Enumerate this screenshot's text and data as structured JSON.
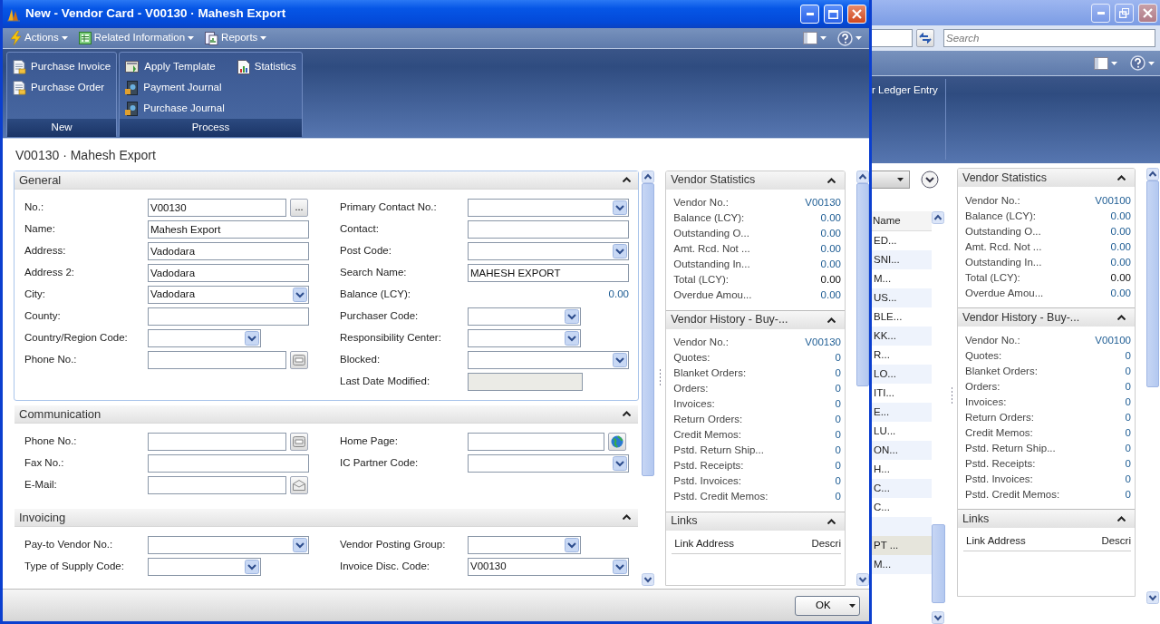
{
  "window": {
    "title": "New - Vendor Card - V00130 · Mahesh Export"
  },
  "menu": [
    {
      "label": "Actions",
      "kind": "bolt"
    },
    {
      "label": "Related Information",
      "kind": "grid"
    },
    {
      "label": "Reports",
      "kind": "report"
    }
  ],
  "ribbon": [
    {
      "label": "New",
      "actions": [
        {
          "label": "Purchase Invoice",
          "kind": "document"
        },
        {
          "label": "Purchase Order",
          "kind": "document"
        }
      ]
    },
    {
      "label": "Process",
      "actions": [
        {
          "label": "Apply Template",
          "kind": "template"
        },
        {
          "label": "Payment Journal",
          "kind": "journal"
        },
        {
          "label": "Purchase Journal",
          "kind": "journal"
        },
        {
          "label": "Statistics",
          "kind": "chart"
        }
      ]
    }
  ],
  "page_title": "V00130 · Mahesh Export",
  "fasttabs": [
    {
      "title": "General",
      "expanded": true,
      "left": [
        {
          "label": "No.:",
          "value": "V00130",
          "kind": "assist",
          "button": "..."
        },
        {
          "label": "Name:",
          "value": "Mahesh Export",
          "kind": "text"
        },
        {
          "label": "Address:",
          "value": "Vadodara",
          "kind": "text"
        },
        {
          "label": "Address 2:",
          "value": "Vadodara",
          "kind": "text"
        },
        {
          "label": "City:",
          "value": "Vadodara",
          "kind": "combo"
        },
        {
          "label": "County:",
          "kind": "text"
        },
        {
          "label": "Country/Region Code:",
          "kind": "short-combo"
        },
        {
          "label": "Phone No.:",
          "kind": "phone"
        }
      ],
      "right": [
        {
          "label": "Primary Contact No.:",
          "kind": "combo"
        },
        {
          "label": "Contact:",
          "kind": "text"
        },
        {
          "label": "Post Code:",
          "kind": "combo"
        },
        {
          "label": "Search Name:",
          "value": "MAHESH EXPORT",
          "kind": "text"
        },
        {
          "label": "Balance (LCY):",
          "value": "0.00",
          "kind": "value"
        },
        {
          "label": "Purchaser Code:",
          "kind": "short-combo"
        },
        {
          "label": "Responsibility Center:",
          "kind": "short-combo"
        },
        {
          "label": "Blocked:",
          "kind": "combo"
        },
        {
          "label": "Last Date Modified:",
          "kind": "readonly"
        }
      ]
    },
    {
      "title": "Communication",
      "expanded": true,
      "left": [
        {
          "label": "Phone No.:",
          "kind": "phone"
        },
        {
          "label": "Fax No.:",
          "kind": "text"
        },
        {
          "label": "E-Mail:",
          "kind": "email"
        }
      ],
      "right": [
        {
          "label": "Home Page:",
          "kind": "web"
        },
        {
          "label": "IC Partner Code:",
          "kind": "combo"
        }
      ]
    },
    {
      "title": "Invoicing",
      "expanded": true,
      "left": [
        {
          "label": "Pay-to Vendor No.:",
          "kind": "combo"
        },
        {
          "label": "Type of Supply Code:",
          "kind": "short-combo"
        }
      ],
      "right": [
        {
          "label": "Vendor Posting Group:",
          "kind": "short-combo"
        },
        {
          "label": "Invoice Disc. Code:",
          "value": "V00130",
          "kind": "combo"
        }
      ]
    }
  ],
  "factboxes": [
    {
      "title": "Vendor Statistics",
      "expanded": true,
      "rows": [
        {
          "label": "Vendor No.:",
          "value": "V00130",
          "link": true
        },
        {
          "label": "Balance (LCY):",
          "value": "0.00",
          "link": true
        },
        {
          "label": "Outstanding O...",
          "value": "0.00",
          "link": true
        },
        {
          "label": "Amt. Rcd. Not ...",
          "value": "0.00",
          "link": true
        },
        {
          "label": "Outstanding In...",
          "value": "0.00",
          "link": true
        },
        {
          "label": "Total (LCY):",
          "value": "0.00",
          "link": false
        },
        {
          "label": "Overdue Amou...",
          "value": "0.00",
          "link": true
        }
      ]
    },
    {
      "title": "Vendor History - Buy-...",
      "expanded": true,
      "rows": [
        {
          "label": "Vendor No.:",
          "value": "V00130",
          "link": true
        },
        {
          "label": "Quotes:",
          "value": "0",
          "link": true
        },
        {
          "label": "Blanket Orders:",
          "value": "0",
          "link": true
        },
        {
          "label": "Orders:",
          "value": "0",
          "link": true
        },
        {
          "label": "Invoices:",
          "value": "0",
          "link": true
        },
        {
          "label": "Return Orders:",
          "value": "0",
          "link": true
        },
        {
          "label": "Credit Memos:",
          "value": "0",
          "link": true
        },
        {
          "label": "Pstd. Return Ship...",
          "value": "0",
          "link": true
        },
        {
          "label": "Pstd. Receipts:",
          "value": "0",
          "link": true
        },
        {
          "label": "Pstd. Invoices:",
          "value": "0",
          "link": true
        },
        {
          "label": "Pstd. Credit Memos:",
          "value": "0",
          "link": true
        }
      ]
    },
    {
      "title": "Links",
      "expanded": true,
      "columns": [
        "Link Address",
        "Descri"
      ]
    }
  ],
  "footer": {
    "ok": "OK"
  },
  "background_window": {
    "search": {
      "placeholder": "Search"
    },
    "ribbon_action": "r Ledger Entry",
    "list": {
      "column": "Name",
      "rows": [
        {
          "name": "ED...",
          "selected": false
        },
        {
          "name": "SNI...",
          "selected": false
        },
        {
          "name": "M...",
          "selected": false
        },
        {
          "name": "US...",
          "selected": false
        },
        {
          "name": "BLE...",
          "selected": false
        },
        {
          "name": "KK...",
          "selected": false
        },
        {
          "name": "R...",
          "selected": false
        },
        {
          "name": "LO...",
          "selected": false
        },
        {
          "name": "ITI...",
          "selected": false
        },
        {
          "name": "E...",
          "selected": false
        },
        {
          "name": "LU...",
          "selected": false
        },
        {
          "name": "ON...",
          "selected": false
        },
        {
          "name": "H...",
          "selected": false
        },
        {
          "name": "C...",
          "selected": false
        },
        {
          "name": "C...",
          "selected": false
        },
        {
          "selected": false
        },
        {
          "name": "PT ...",
          "selected": true
        },
        {
          "name": "M...",
          "selected": false
        }
      ]
    },
    "factboxes": [
      {
        "title": "Vendor Statistics",
        "expanded": true,
        "rows": [
          {
            "label": "Vendor No.:",
            "value": "V00100",
            "link": true
          },
          {
            "label": "Balance (LCY):",
            "value": "0.00",
            "link": true
          },
          {
            "label": "Outstanding O...",
            "value": "0.00",
            "link": true
          },
          {
            "label": "Amt. Rcd. Not ...",
            "value": "0.00",
            "link": true
          },
          {
            "label": "Outstanding In...",
            "value": "0.00",
            "link": true
          },
          {
            "label": "Total (LCY):",
            "value": "0.00",
            "link": false
          },
          {
            "label": "Overdue Amou...",
            "value": "0.00",
            "link": true
          }
        ]
      },
      {
        "title": "Vendor History - Buy-...",
        "expanded": true,
        "rows": [
          {
            "label": "Vendor No.:",
            "value": "V00100",
            "link": true
          },
          {
            "label": "Quotes:",
            "value": "0",
            "link": true
          },
          {
            "label": "Blanket Orders:",
            "value": "0",
            "link": true
          },
          {
            "label": "Orders:",
            "value": "0",
            "link": true
          },
          {
            "label": "Invoices:",
            "value": "0",
            "link": true
          },
          {
            "label": "Return Orders:",
            "value": "0",
            "link": true
          },
          {
            "label": "Credit Memos:",
            "value": "0",
            "link": true
          },
          {
            "label": "Pstd. Return Ship...",
            "value": "0",
            "link": true
          },
          {
            "label": "Pstd. Receipts:",
            "value": "0",
            "link": true
          },
          {
            "label": "Pstd. Invoices:",
            "value": "0",
            "link": true
          },
          {
            "label": "Pstd. Credit Memos:",
            "value": "0",
            "link": true
          }
        ]
      },
      {
        "title": "Links",
        "expanded": true,
        "columns": [
          "Link Address",
          "Descri"
        ]
      }
    ]
  }
}
